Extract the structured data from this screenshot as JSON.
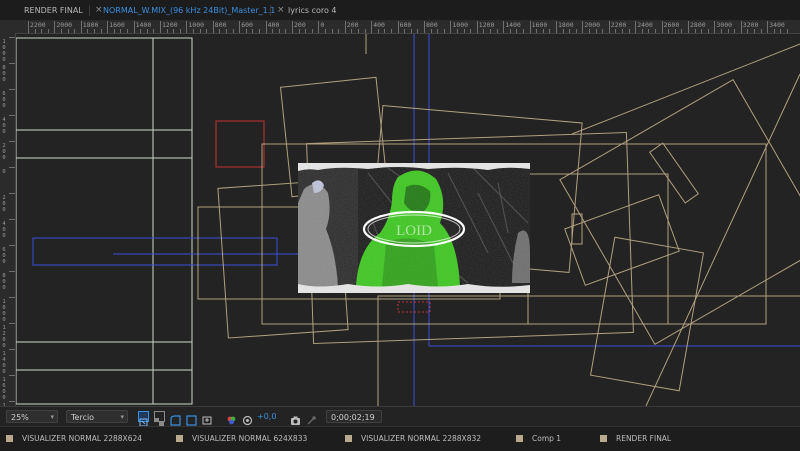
{
  "tabs": [
    {
      "label": "RENDER FINAL",
      "color": "#b8b8b8",
      "active": false
    },
    {
      "label": "NORMAL_W.MIX_(96 kHz 24Bit)_Master_1.1",
      "color": "#3a8fe0",
      "active": true
    },
    {
      "label": "lyrics coro 4",
      "color": "#b8b8b8",
      "active": false
    }
  ],
  "close_glyph": "×",
  "ruler_top": [
    "2200",
    "2000",
    "1800",
    "1600",
    "1400",
    "1200",
    "1000",
    "800",
    "600",
    "400",
    "200",
    "0",
    "200",
    "400",
    "600",
    "800",
    "1000",
    "1200",
    "1400",
    "1600",
    "1800",
    "2000",
    "2200",
    "2400",
    "2600",
    "2800",
    "3000",
    "3200",
    "3400"
  ],
  "ruler_left": [
    "1000",
    "800",
    "600",
    "400",
    "200",
    "0",
    "200",
    "400",
    "600",
    "800",
    "1000",
    "1200",
    "1400",
    "1600",
    "1800"
  ],
  "viewer": {
    "frame_logo_text": "LOID",
    "accent_green": "#3cc81e",
    "guide_blue": "#3d4fd8",
    "layer_outline": "#c9b690"
  },
  "toolbar": {
    "zoom": "25%",
    "resolution": "Tercio",
    "exposure": "+0,0",
    "timecode": "0;00;02;19",
    "icons": [
      "region-of-interest-icon",
      "transparency-grid-icon",
      "mask-visibility-icon",
      "guides-icon",
      "3d-view-icon",
      "color-channels-icon",
      "exposure-reset-icon",
      "snapshot-icon",
      "show-snapshot-icon"
    ]
  },
  "layers": [
    {
      "label": "VISUALIZER NORMAL 2288X624"
    },
    {
      "label": "VISUALIZER NORMAL 624X833"
    },
    {
      "label": "VISUALIZER NORMAL 2288X832"
    },
    {
      "label": "Comp 1"
    },
    {
      "label": "RENDER FINAL"
    }
  ]
}
